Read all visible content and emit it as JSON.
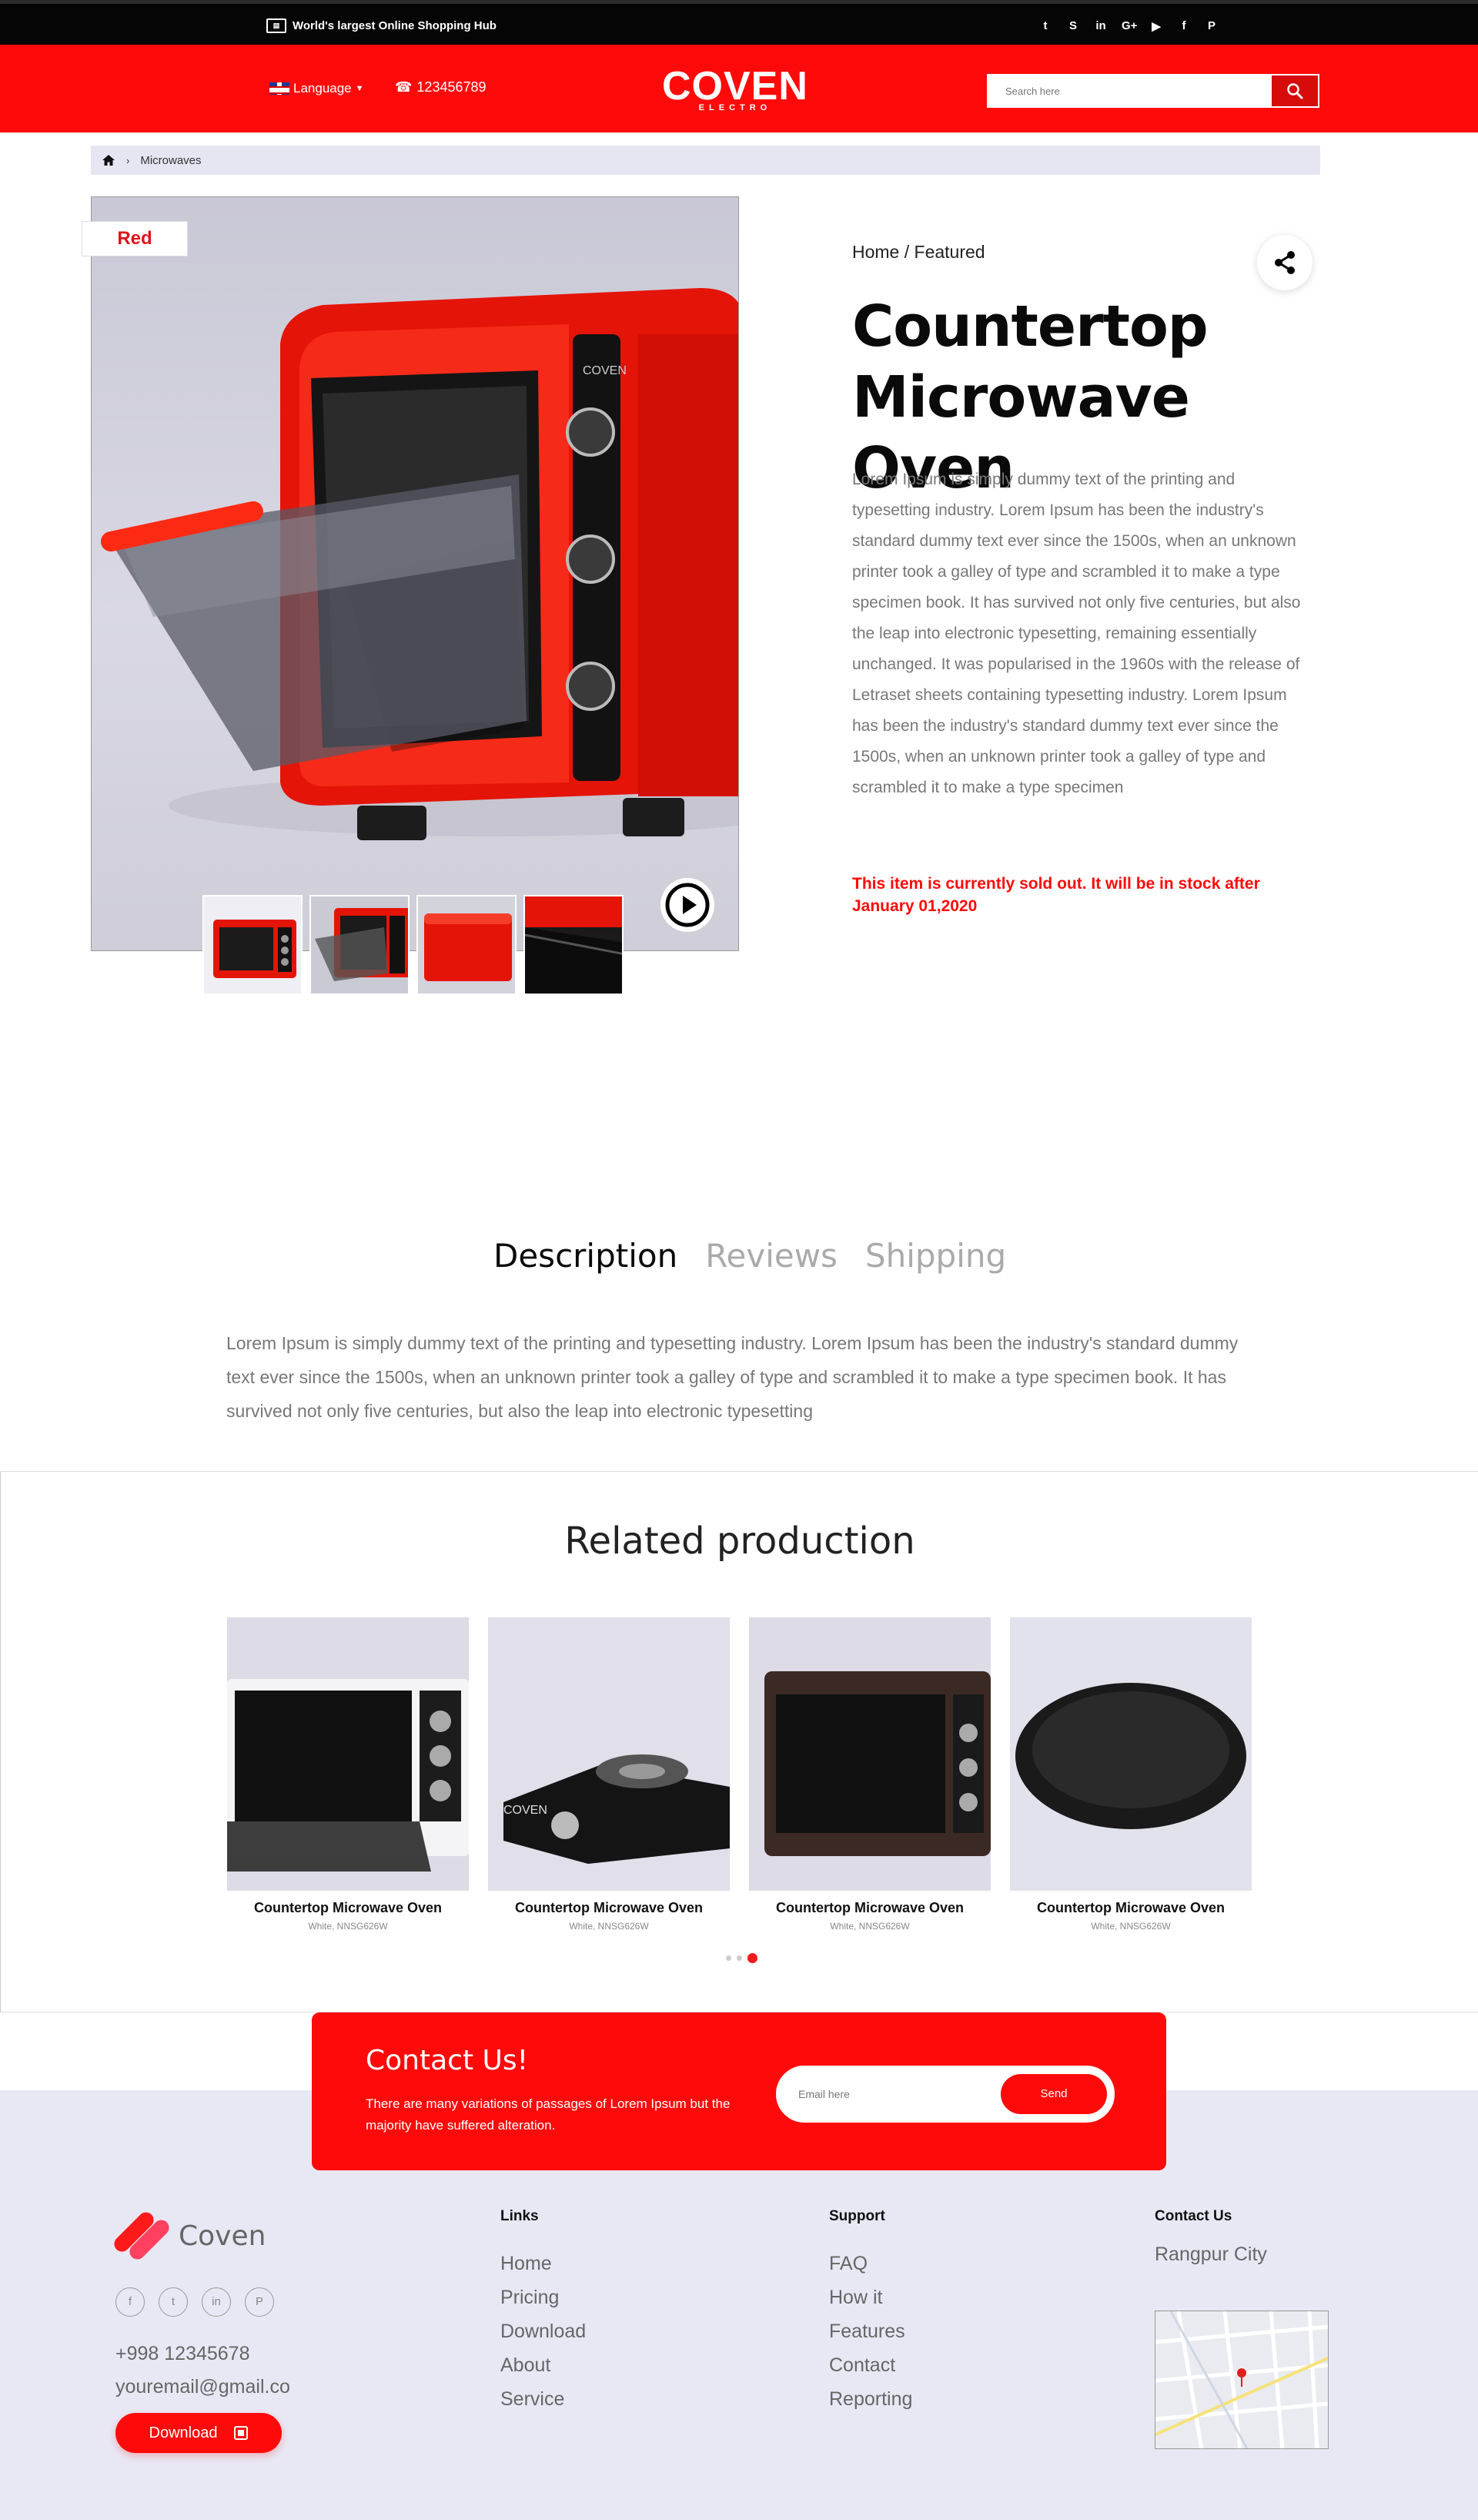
{
  "topbar": {
    "hub_text": "World's largest Online Shopping Hub",
    "socials": [
      "twitter-icon",
      "skype-icon",
      "linkedin-icon",
      "google-plus-icon",
      "youtube-icon",
      "facebook-icon",
      "pinterest-icon"
    ]
  },
  "header": {
    "language_label": "Language",
    "phone": "123456789",
    "logo_main": "COVEN",
    "logo_sub": "ELECTRO",
    "search_placeholder": "Search here"
  },
  "breadcrumb": {
    "current": "Microwaves"
  },
  "product": {
    "color_tag": "Red",
    "path": "Home / Featured",
    "title": "Countertop Microwave Oven",
    "description": "Lorem Ipsum is simply dummy text of the printing and typesetting industry. Lorem Ipsum has been the industry's standard dummy text ever since the 1500s, when an unknown printer took a galley of type and scrambled it to make a type specimen book. It has survived not only five centuries, but also the leap into electronic typesetting, remaining essentially unchanged. It was popularised in the 1960s with the release of Letraset sheets containing typesetting industry. Lorem Ipsum has been the industry's standard dummy text ever since the 1500s, when an unknown printer took a galley of type and scrambled it to make a type specimen",
    "sold_out": "This item is currently sold out. It will be in stock after January 01,2020"
  },
  "tabs": {
    "items": [
      "Description",
      "Reviews",
      "Shipping"
    ],
    "active": "Description",
    "content": "Lorem Ipsum is simply dummy text of the printing and typesetting industry. Lorem Ipsum has been the industry's standard dummy text ever since the 1500s, when an unknown printer took a galley of type and scrambled it to make a type specimen book. It has survived not only five centuries, but also the leap into electronic typesetting"
  },
  "related": {
    "title": "Related production",
    "cards": [
      {
        "title": "Countertop Microwave Oven",
        "sub": "White, NNSG626W"
      },
      {
        "title": "Countertop Microwave Oven",
        "sub": "White, NNSG626W"
      },
      {
        "title": "Countertop Microwave Oven",
        "sub": "White, NNSG626W"
      },
      {
        "title": "Countertop Microwave Oven",
        "sub": "White, NNSG626W"
      }
    ]
  },
  "contact": {
    "title": "Contact Us!",
    "text": "There are many variations of passages of Lorem Ipsum but the majority have suffered alteration.",
    "email_placeholder": "Email here",
    "send_label": "Send"
  },
  "footer": {
    "brand": "Coven",
    "phone": "+998 12345678",
    "email": "youremail@gmail.co",
    "download_label": "Download",
    "links": {
      "title": "Links",
      "items": [
        "Home",
        "Pricing",
        "Download",
        "About",
        "Service"
      ]
    },
    "support": {
      "title": "Support",
      "items": [
        "FAQ",
        "How it",
        "Features",
        "Contact",
        "Reporting"
      ]
    },
    "contact": {
      "title": "Contact Us",
      "city": "Rangpur City"
    }
  },
  "colors": {
    "brand_red": "#ff0a0a",
    "topbar": "#050505",
    "footer_bg": "#e8e8f4"
  }
}
